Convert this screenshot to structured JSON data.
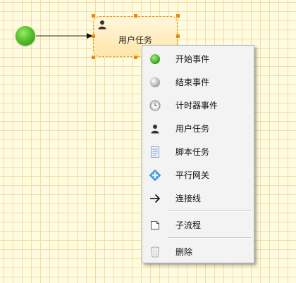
{
  "diagram": {
    "task": {
      "label": "用户任务",
      "icon": "user-icon"
    }
  },
  "context_menu": {
    "items": [
      {
        "label": "开始事件",
        "icon": "start-event-icon"
      },
      {
        "label": "结束事件",
        "icon": "end-event-icon"
      },
      {
        "label": "计时器事件",
        "icon": "timer-icon"
      },
      {
        "label": "用户任务",
        "icon": "user-icon"
      },
      {
        "label": "脚本任务",
        "icon": "script-icon"
      },
      {
        "label": "平行网关",
        "icon": "parallel-gateway-icon"
      },
      {
        "label": "连接线",
        "icon": "arrow-right-icon"
      },
      {
        "label": "子流程",
        "icon": "subprocess-icon"
      },
      {
        "label": "删除",
        "icon": "trash-icon"
      }
    ]
  },
  "colors": {
    "canvas_bg": "#fffbe0",
    "grid_line": "#f0dfa4",
    "selection_handle": "#f08a00",
    "start_event_green": "#56c22a"
  }
}
